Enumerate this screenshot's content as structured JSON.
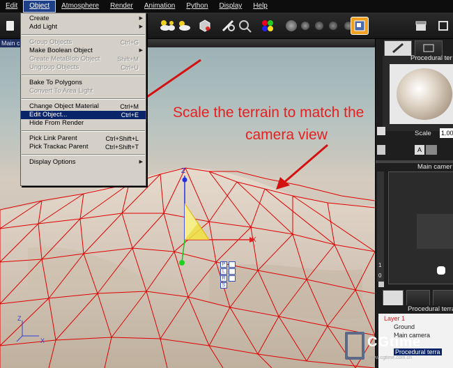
{
  "menubar": {
    "items": [
      "Edit",
      "Object",
      "Atmosphere",
      "Render",
      "Animation",
      "Python",
      "Display",
      "Help"
    ],
    "active_index": 1
  },
  "viewport": {
    "title": "Main c"
  },
  "object_menu": {
    "items": [
      {
        "label": "Create",
        "shortcut": "",
        "submenu": true,
        "disabled": false
      },
      {
        "label": "Add Light",
        "shortcut": "",
        "submenu": true,
        "disabled": false
      },
      {
        "label": "Group Objects",
        "shortcut": "Ctrl+G",
        "submenu": false,
        "disabled": true
      },
      {
        "label": "Make Boolean Object",
        "shortcut": "",
        "submenu": true,
        "disabled": false
      },
      {
        "label": "Create MetaBlob Object",
        "shortcut": "Shift+M",
        "submenu": false,
        "disabled": true
      },
      {
        "label": "Ungroup Objects",
        "shortcut": "Ctrl+U",
        "submenu": false,
        "disabled": true
      },
      {
        "label": "Bake To Polygons",
        "shortcut": "",
        "submenu": false,
        "disabled": false
      },
      {
        "label": "Convert To Area Light",
        "shortcut": "",
        "submenu": false,
        "disabled": true
      },
      {
        "label": "Change Object Material",
        "shortcut": "Ctrl+M",
        "submenu": false,
        "disabled": false
      },
      {
        "label": "Edit Object...",
        "shortcut": "Ctrl+E",
        "submenu": false,
        "disabled": false,
        "selected": true
      },
      {
        "label": "Hide From Render",
        "shortcut": "",
        "submenu": false,
        "disabled": false
      },
      {
        "label": "Pick Link Parent",
        "shortcut": "Ctrl+Shift+L",
        "submenu": false,
        "disabled": false
      },
      {
        "label": "Pick Trackac Parent",
        "shortcut": "Ctrl+Shift+T",
        "submenu": false,
        "disabled": false
      },
      {
        "label": "Display Options",
        "shortcut": "",
        "submenu": true,
        "disabled": false
      }
    ]
  },
  "annotation": {
    "line1": "Scale the terrain to match the",
    "line2": "camera view",
    "color": "#e62020"
  },
  "right_panel": {
    "material_title": "Procedural ter",
    "scale_label": "Scale",
    "scale_value": "1.00",
    "camera_title": "Main camer",
    "tree_title": "Procedural terra",
    "tree_items": [
      "Layer 1",
      "Ground",
      "Main camera",
      "Procedural terra"
    ],
    "ruler_values": [
      "1",
      "0"
    ],
    "ab_label": "A"
  },
  "gizmo": {
    "axis_x": "X",
    "axis_z": "Z",
    "buttons": [
      "P",
      "L",
      "R",
      "S"
    ],
    "colors": {
      "x": "#e02020",
      "y": "#20c020",
      "z": "#2030e0"
    }
  },
  "corner_axes": {
    "z": "Z",
    "x": "X"
  },
  "watermark": {
    "text": "CGtime",
    "url": "www.cgtime.com.cn"
  }
}
